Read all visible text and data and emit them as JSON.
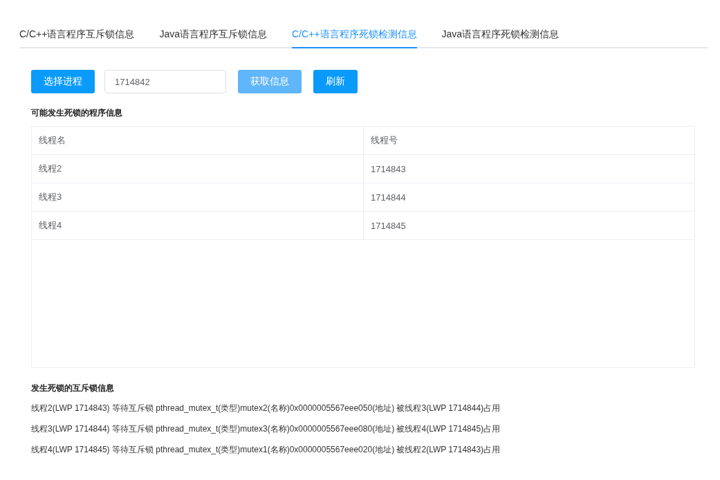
{
  "tabs": [
    {
      "label": "C/C++语言程序互斥锁信息",
      "selected": false
    },
    {
      "label": "Java语言程序互斥锁信息",
      "selected": false
    },
    {
      "label": "C/C++语言程序死锁检测信息",
      "selected": true
    },
    {
      "label": "Java语言程序死锁检测信息",
      "selected": false
    }
  ],
  "toolbar": {
    "select_button": "选择进程",
    "process_field": {
      "value": "1714842"
    },
    "fetch_button": {
      "label": "获取信息",
      "disabled": true
    },
    "refresh_button": "刷新"
  },
  "program_section": {
    "title": "可能发生死锁的程序信息",
    "table": {
      "columns": [
        "线程名",
        "线程号"
      ],
      "rows": [
        [
          "线程2",
          "1714843"
        ],
        [
          "线程3",
          "1714844"
        ],
        [
          "线程4",
          "1714845"
        ]
      ]
    }
  },
  "mutex_section": {
    "title": "发生死锁的互斥锁信息",
    "lines": [
      "线程2(LWP 1714843) 等待互斥锁 pthread_mutex_t(类型)mutex2(名称)0x0000005567eee050(地址) 被线程3(LWP 1714844)占用",
      "线程3(LWP 1714844) 等待互斥锁 pthread_mutex_t(类型)mutex3(名称)0x0000005567eee080(地址) 被线程4(LWP 1714845)占用",
      "线程4(LWP 1714845) 等待互斥锁 pthread_mutex_t(类型)mutex1(名称)0x0000005567eee020(地址) 被线程2(LWP 1714843)占用"
    ]
  }
}
